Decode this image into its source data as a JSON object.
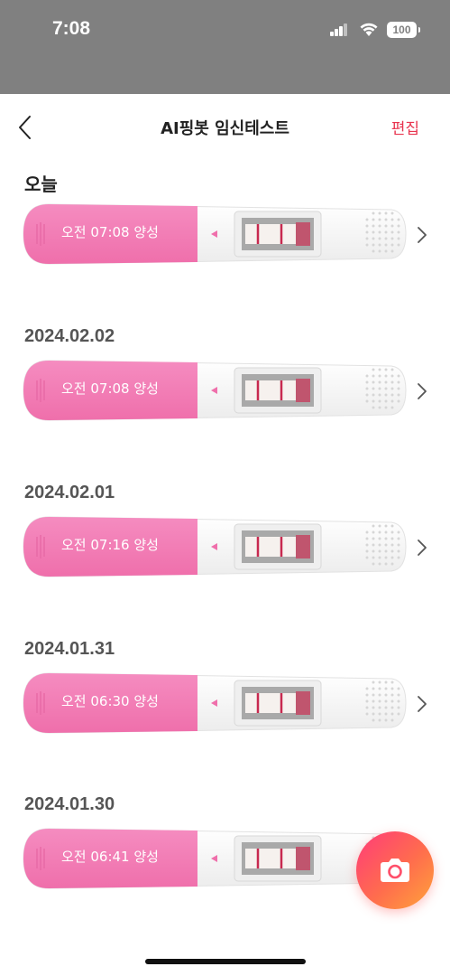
{
  "status_bar": {
    "time": "7:08",
    "battery": "100"
  },
  "nav": {
    "title": "AI핑봇 임신테스트",
    "edit_label": "편집"
  },
  "sections": [
    {
      "date": "오늘",
      "item": {
        "label": "오전 07:08 양성",
        "result_image": "test-strip-positive"
      }
    },
    {
      "date": "2024.02.02",
      "item": {
        "label": "오전 07:08 양성",
        "result_image": "test-strip-positive"
      }
    },
    {
      "date": "2024.02.01",
      "item": {
        "label": "오전 07:16 양성",
        "result_image": "test-strip-positive"
      }
    },
    {
      "date": "2024.01.31",
      "item": {
        "label": "오전 06:30 양성",
        "result_image": "test-strip-positive"
      }
    },
    {
      "date": "2024.01.30",
      "item": {
        "label": "오전 06:41 양성",
        "result_image": "test-strip-positive"
      }
    }
  ],
  "icons": {
    "back": "chevron-left-icon",
    "item_arrow": "chevron-right-icon",
    "camera": "camera-icon"
  },
  "colors": {
    "accent": "#e8344f",
    "test_pink": "#f27eb4",
    "fab_gradient_start": "#ff3b7a",
    "fab_gradient_end": "#ffa43a"
  }
}
